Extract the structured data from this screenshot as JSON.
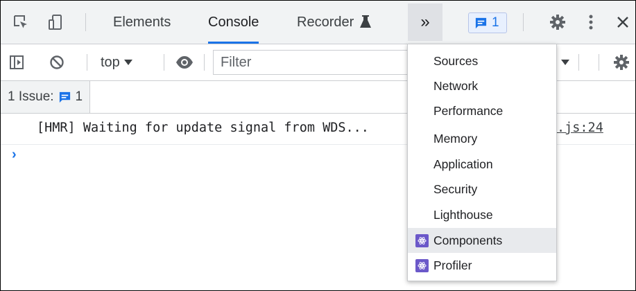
{
  "tabs": [
    {
      "label": "Elements",
      "active": false
    },
    {
      "label": "Console",
      "active": true
    },
    {
      "label": "Recorder",
      "active": false
    }
  ],
  "issues_badge": {
    "count": "1"
  },
  "toolbar": {
    "context": "top",
    "filter_placeholder": "Filter"
  },
  "issue_bar": {
    "label": "1 Issue:",
    "count": "1"
  },
  "console": {
    "messages": [
      {
        "text": "[HMR] Waiting for update signal from WDS...",
        "source": ".js:24"
      }
    ],
    "prompt": "›"
  },
  "more_tabs_menu": {
    "items": [
      {
        "label": "Sources",
        "icon": ""
      },
      {
        "label": "Network",
        "icon": ""
      },
      {
        "label": "Performance",
        "icon": ""
      },
      {
        "label": "Memory",
        "icon": ""
      },
      {
        "label": "Application",
        "icon": ""
      },
      {
        "label": "Security",
        "icon": ""
      },
      {
        "label": "Lighthouse",
        "icon": ""
      },
      {
        "label": "Components",
        "icon": "react-icon",
        "highlighted": true
      },
      {
        "label": "Profiler",
        "icon": "react-icon"
      }
    ]
  },
  "colors": {
    "accent": "#1a73e8",
    "react_icon": "#6b58c9",
    "toolbar_bg": "#f1f3f4"
  }
}
